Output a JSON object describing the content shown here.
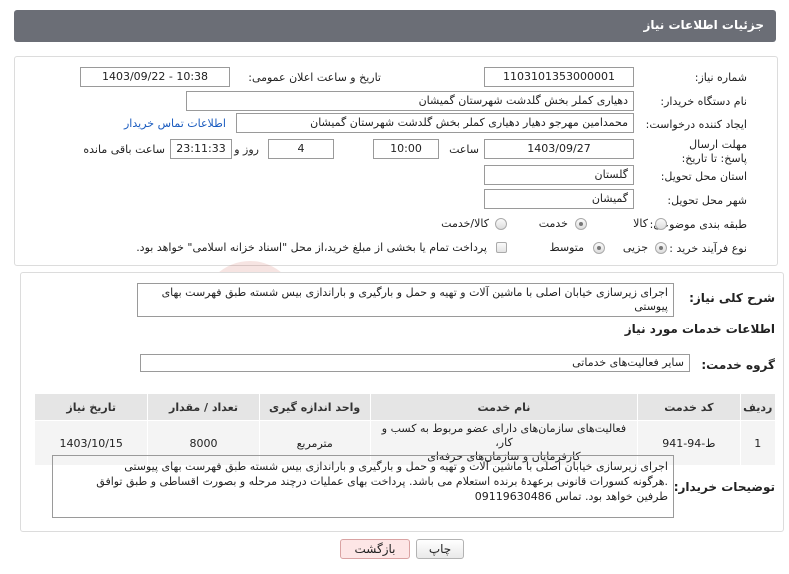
{
  "header": {
    "title": "جزئیات اطلاعات نیاز"
  },
  "form": {
    "need_number_label": "شماره نیاز:",
    "need_number": "1103101353000001",
    "announce_label": "تاریخ و ساعت اعلان عمومی:",
    "announce_value": "1403/09/22 - 10:38",
    "buyer_org_label": "نام دستگاه خریدار:",
    "buyer_org": "دهیاری کملر بخش گلدشت شهرستان گمیشان",
    "creator_label": "ایجاد کننده درخواست:",
    "creator": "محمدامین مهرجو دهیار دهیاری کملر بخش گلدشت شهرستان گمیشان",
    "contact_link": "اطلاعات تماس خریدار",
    "deadline_label": "مهلت ارسال پاسخ: تا تاریخ:",
    "deadline_date": "1403/09/27",
    "time_label": "ساعت",
    "deadline_time": "10:00",
    "days_value": "4",
    "days_label": "روز و",
    "remaining_time": "23:11:33",
    "remaining_label": "ساعت باقی مانده",
    "province_label": "استان محل تحویل:",
    "province": "گلستان",
    "city_label": "شهر محل تحویل:",
    "city": "گمیشان",
    "category_label": "طبقه بندی موضوعی:",
    "category_options": [
      "کالا",
      "خدمت",
      "کالا/خدمت"
    ],
    "category_selected": "خدمت",
    "process_label": "نوع فرآیند خرید :",
    "process_options": [
      "جزیی",
      "متوسط"
    ],
    "process_selected": "جزیی",
    "payment_note": "پرداخت تمام یا بخشی از مبلغ خرید،از محل \"اسناد خزانه اسلامی\" خواهد بود."
  },
  "summary": {
    "label": "شرح کلی نیاز:",
    "text": "اجرای زیرسازی خیابان اصلی با ماشین آلات و تهیه و حمل و بارگیری و باراندازی بیس شسته طبق فهرست بهای پیوستی"
  },
  "services": {
    "section_title": "اطلاعات خدمات مورد نیاز",
    "group_label": "گروه خدمت:",
    "group_value": "سایر فعالیت‌های خدماتی",
    "columns": [
      "ردیف",
      "کد خدمت",
      "نام خدمت",
      "واحد اندازه گیری",
      "تعداد / مقدار",
      "تاریخ نیاز"
    ],
    "rows": [
      {
        "row": "1",
        "code": "ط-94-941",
        "name_line1": "فعالیت‌های سازمان‌های دارای عضو مربوط به کسب و کار،",
        "name_line2": "کارفرمایان و سازمان‌های حرفه‌ای",
        "unit": "مترمربع",
        "qty": "8000",
        "date": "1403/10/15"
      }
    ]
  },
  "buyer_notes": {
    "label": "توضیحات خریدار:",
    "line1": "اجرای زیرسازی خیابان اصلی با ماشین آلات و تهیه و حمل و بارگیری و باراندازی بیس شسته طبق فهرست بهای پیوستی",
    "line2": ".هرگونه کسورات قانونی برعهدهٔ برنده استعلام می باشد. پرداخت بهای عملیات درچند مرحله و بصورت اقساطی و طبق توافق",
    "line3": "طرفین خواهد بود. تماس 09119630486"
  },
  "buttons": {
    "print": "چاپ",
    "back": "بازگشت"
  },
  "watermark": {
    "text": "AriaTender.neT"
  },
  "colors": {
    "header_bg": "#6b6e76",
    "link": "#1a5bbf",
    "back_button_bg": "#fde6e6",
    "watermark": "#c0392b"
  }
}
